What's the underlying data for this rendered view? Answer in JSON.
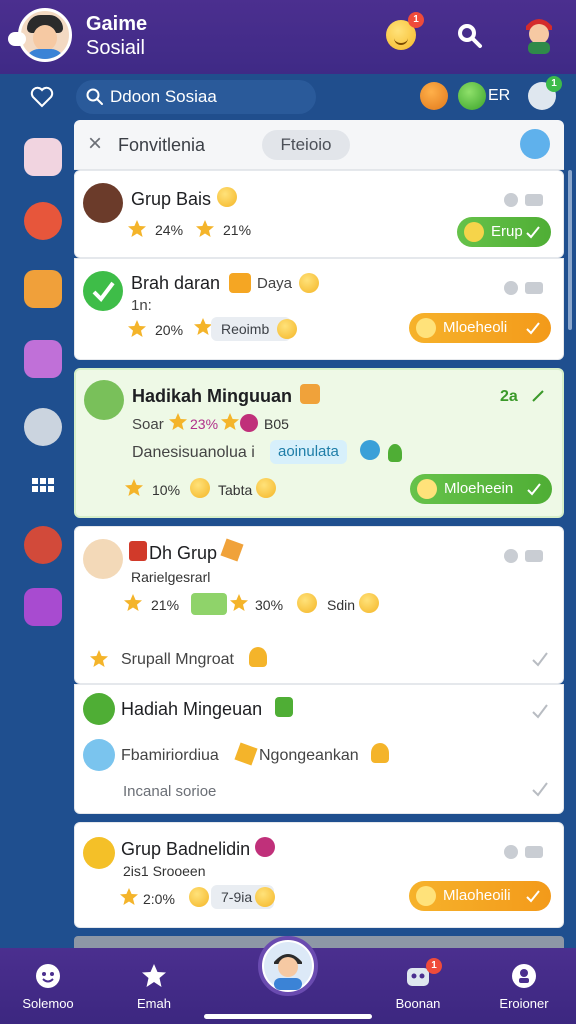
{
  "header": {
    "title_line1": "Gaime",
    "title_line2": "Sosiail",
    "notif_badge": "1"
  },
  "search": {
    "placeholder": "Ddoon Sosiaa",
    "chip_label": "ER",
    "chip_badge": "1"
  },
  "panel": {
    "title": "Fonvitlenia",
    "pill": "Fteioio"
  },
  "cards": [
    {
      "name": "Grup Bais",
      "stat1": "24%",
      "stat2": "21%",
      "button": "Erup"
    },
    {
      "name": "Brah daran",
      "name_suffix": "Daya",
      "sub": "1n:",
      "stat1": "20%",
      "tag": "Reoimb",
      "button": "Mloeheoli"
    },
    {
      "name": "Hadikah Minguuan",
      "corner": "2a",
      "sub": "Soar",
      "sub_stat": "23%",
      "sub_stat2": "B05",
      "desc": "Danesisuanolua i",
      "highlight": "aoinulata",
      "stat1": "10%",
      "stat2": "Tabta",
      "button": "Mloeheein"
    },
    {
      "name": "Dh Grup",
      "sub": "Rarielgesrarl",
      "stat1": "21%",
      "stat2": "30%",
      "stat3": "Sdin",
      "row2": "Srupall Mngroat"
    },
    {
      "row1": "Hadiah Mingeuan",
      "row2": "Fbamiriordiua",
      "row2_b": "Ngongeankan",
      "row3": "Incanal sorioe"
    },
    {
      "name": "Grup Badnelidin",
      "sub": "2is1 Srooeen",
      "stat1": "2:0%",
      "stat2": "7-9ia",
      "button": "Mlaoheoili"
    }
  ],
  "bottom_nav": [
    {
      "label": "Solemoo",
      "icon": "smiley-icon"
    },
    {
      "label": "Emah",
      "icon": "star-icon"
    },
    {
      "label": "Boonan",
      "icon": "robot-icon",
      "badge": "1"
    },
    {
      "label": "Eroioner",
      "icon": "medal-icon"
    }
  ],
  "colors": {
    "header": "#4b2f8f",
    "background": "#1f4f8f",
    "green": "#5bb842",
    "orange": "#f5a623",
    "highlight_card": "#eef9e6"
  }
}
